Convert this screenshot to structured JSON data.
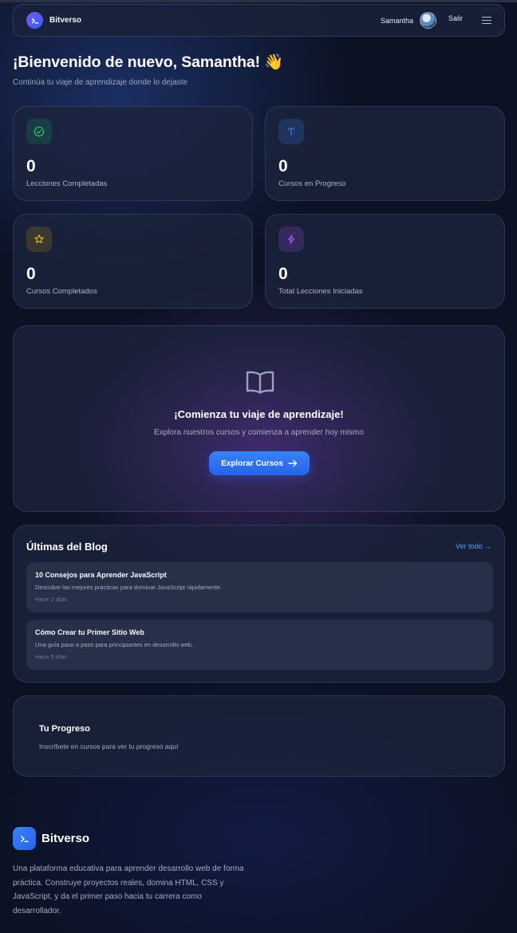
{
  "app": {
    "brand": "Bitverso"
  },
  "header": {
    "user_name": "Samantha",
    "logout_label": "Salir"
  },
  "welcome": {
    "title": "¡Bienvenido de nuevo, Samantha! 👋",
    "subtitle": "Continúa tu viaje de aprendizaje donde lo dejaste"
  },
  "stats": [
    {
      "value": "0",
      "label": "Lecciones Completadas",
      "icon": "check-circle-icon",
      "color": "#22c55e"
    },
    {
      "value": "0",
      "label": "Cursos en Progreso",
      "icon": "cursor-icon",
      "color": "#3b82f6"
    },
    {
      "value": "0",
      "label": "Cursos Completados",
      "icon": "star-icon",
      "color": "#eab308"
    },
    {
      "value": "0",
      "label": "Total Lecciones Iniciadas",
      "icon": "lightning-icon",
      "color": "#a855f7"
    }
  ],
  "cta": {
    "title": "¡Comienza tu viaje de aprendizaje!",
    "subtitle": "Explora nuestros cursos y comienza a aprender hoy mismo",
    "button_label": "Explorar Cursos"
  },
  "blog": {
    "title": "Últimas del Blog",
    "view_all": "Ver todo →",
    "posts": [
      {
        "title": "10 Consejos para Aprender JavaScript",
        "description": "Descubre las mejores prácticas para dominar JavaScript rápidamente.",
        "date": "Hace 2 días"
      },
      {
        "title": "Cómo Crear tu Primer Sitio Web",
        "description": "Una guía paso a paso para principiantes en desarrollo web.",
        "date": "Hace 5 días"
      }
    ]
  },
  "progress": {
    "title": "Tu Progreso",
    "subtitle": "Inscríbete en cursos para ver tu progreso aquí"
  },
  "footer": {
    "brand": "Bitverso",
    "description": "Una plataforma educativa para aprender desarrollo web de forma práctica. Construye proyectos reales, domina HTML, CSS y JavaScript, y da el primer paso hacia tu carrera como desarrollador."
  },
  "colors": {
    "accent": "#3b82f6",
    "link": "#5aa0f5",
    "background": "#0c1224"
  }
}
